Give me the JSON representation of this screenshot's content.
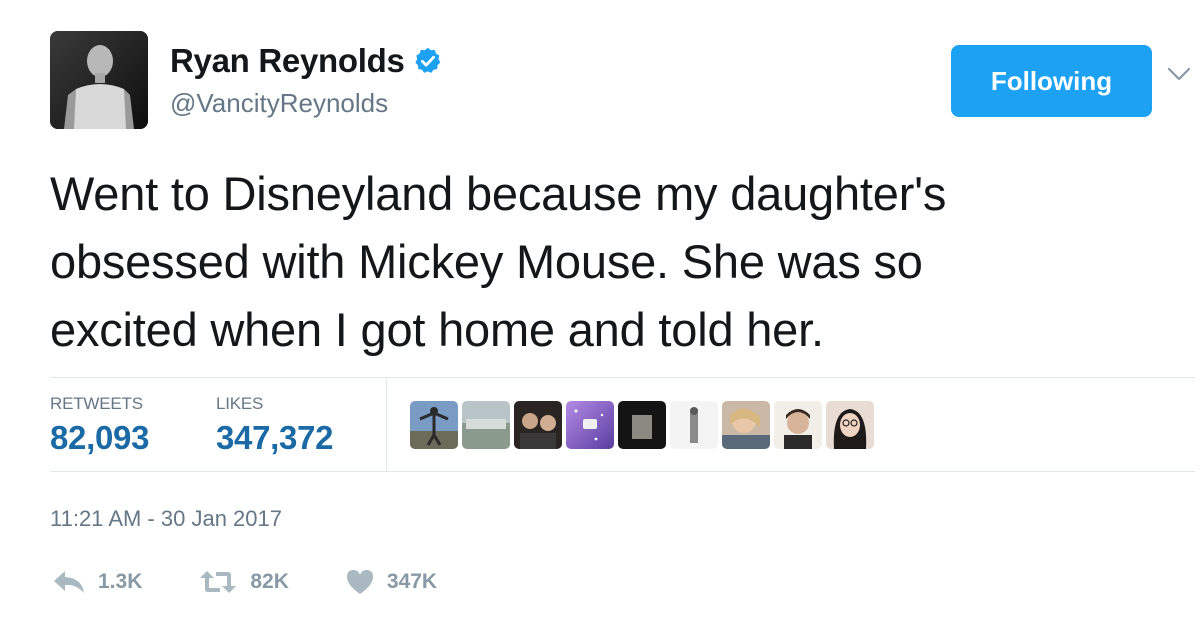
{
  "user": {
    "display_name": "Ryan Reynolds",
    "handle": "@VancityReynolds",
    "verified": true
  },
  "follow_button": {
    "label": "Following"
  },
  "tweet": {
    "lines": [
      "Went to Disneyland because my daughter's",
      "obsessed with Mickey Mouse. She was so",
      "excited when I got home and told her."
    ]
  },
  "stats": {
    "retweets_label": "RETWEETS",
    "retweets_value": "82,093",
    "likes_label": "LIKES",
    "likes_value": "347,372"
  },
  "timestamp": "11:21 AM - 30 Jan 2017",
  "actions": {
    "reply_count": "1.3K",
    "retweet_count": "82K",
    "like_count": "347K"
  },
  "colors": {
    "brand_blue": "#1da1f2",
    "stat_value": "#1b6aa5",
    "muted": "#657786"
  },
  "icons": [
    "verified-icon",
    "chevron-down-icon",
    "reply-icon",
    "retweet-icon",
    "heart-icon"
  ]
}
